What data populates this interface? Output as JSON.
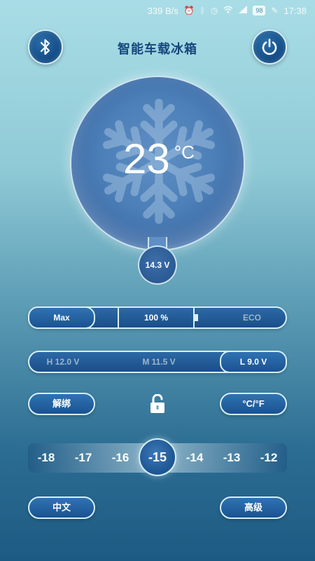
{
  "status_bar": {
    "network_speed": "339 B/s",
    "battery_level": "98",
    "time": "17:38",
    "icons": [
      "alarm-icon",
      "bluetooth-icon",
      "clock-icon",
      "wifi-icon",
      "signal-icon",
      "charging-icon"
    ]
  },
  "header": {
    "title": "智能车载冰箱",
    "bluetooth_icon": "bluetooth-icon",
    "power_icon": "power-icon"
  },
  "display": {
    "temperature": "23",
    "unit": "°C",
    "voltage": "14.3 V",
    "background_icon": "snowflake-icon"
  },
  "mode_selector": {
    "max_label": "Max",
    "battery_percent": "100 %",
    "eco_label": "ECO",
    "active": "Max"
  },
  "battery_protection": {
    "high_label": "H 12.0 V",
    "medium_label": "M 11.5 V",
    "low_label": "L 9.0 V",
    "active": "L 9.0 V"
  },
  "actions": {
    "unbind_label": "解绑",
    "unit_toggle_label": "°C/°F",
    "lock_icon": "unlock-icon"
  },
  "temperature_ruler": {
    "values": [
      "-18",
      "-17",
      "-16",
      "-15",
      "-14",
      "-13",
      "-12"
    ],
    "selected": "-15"
  },
  "footer": {
    "language_label": "中文",
    "advanced_label": "高级"
  },
  "colors": {
    "accent": "#1b5291",
    "title": "#14477c",
    "border": "#d6f0f6"
  }
}
